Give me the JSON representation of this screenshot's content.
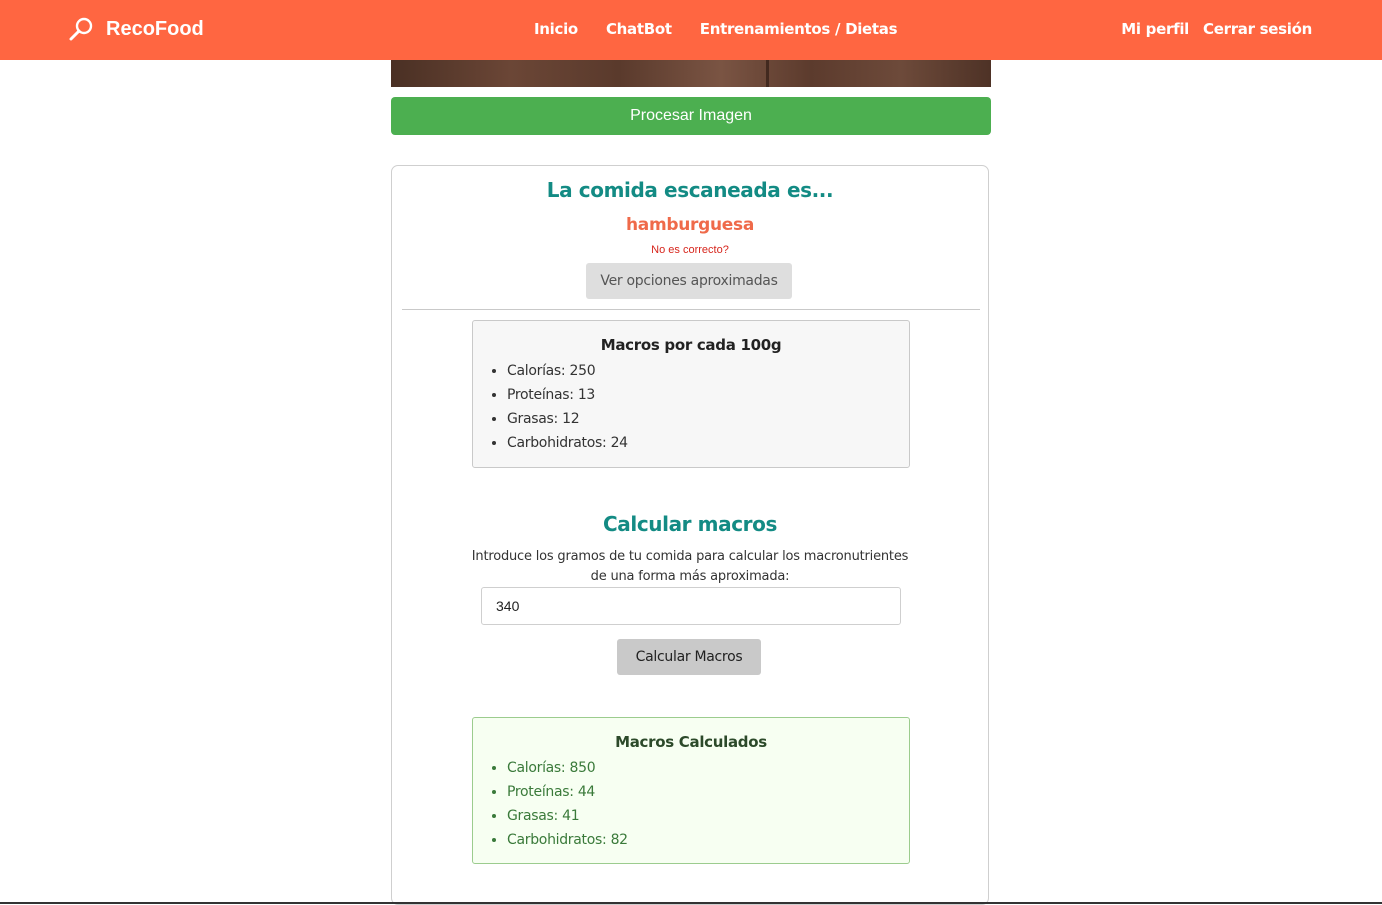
{
  "nav": {
    "brand": "RecoFood",
    "links": [
      "Inicio",
      "ChatBot",
      "Entrenamientos / Dietas"
    ],
    "right_links": [
      "Mi perfil",
      "Cerrar sesión"
    ],
    "accent": "#ff6641"
  },
  "upload": {
    "process_label": "Procesar Imagen"
  },
  "result": {
    "heading": "La comida escaneada es...",
    "food": "hamburguesa",
    "not_correct": "No es correcto?",
    "options_label": "Ver opciones aproximadas"
  },
  "base_macros": {
    "title": "Macros por cada 100g",
    "items": [
      "Calorías: 250",
      "Proteínas: 13",
      "Grasas: 12",
      "Carbohidratos: 24"
    ]
  },
  "calculator": {
    "heading": "Calcular macros",
    "description_line1": "Introduce los gramos de tu comida para calcular los macronutrientes",
    "description_line2": "de una forma más aproximada:",
    "grams_value": "340",
    "button_label": "Calcular Macros"
  },
  "calculated_macros": {
    "title": "Macros Calculados",
    "items": [
      "Calorías: 850",
      "Proteínas: 44",
      "Grasas: 41",
      "Carbohidratos: 82"
    ]
  }
}
